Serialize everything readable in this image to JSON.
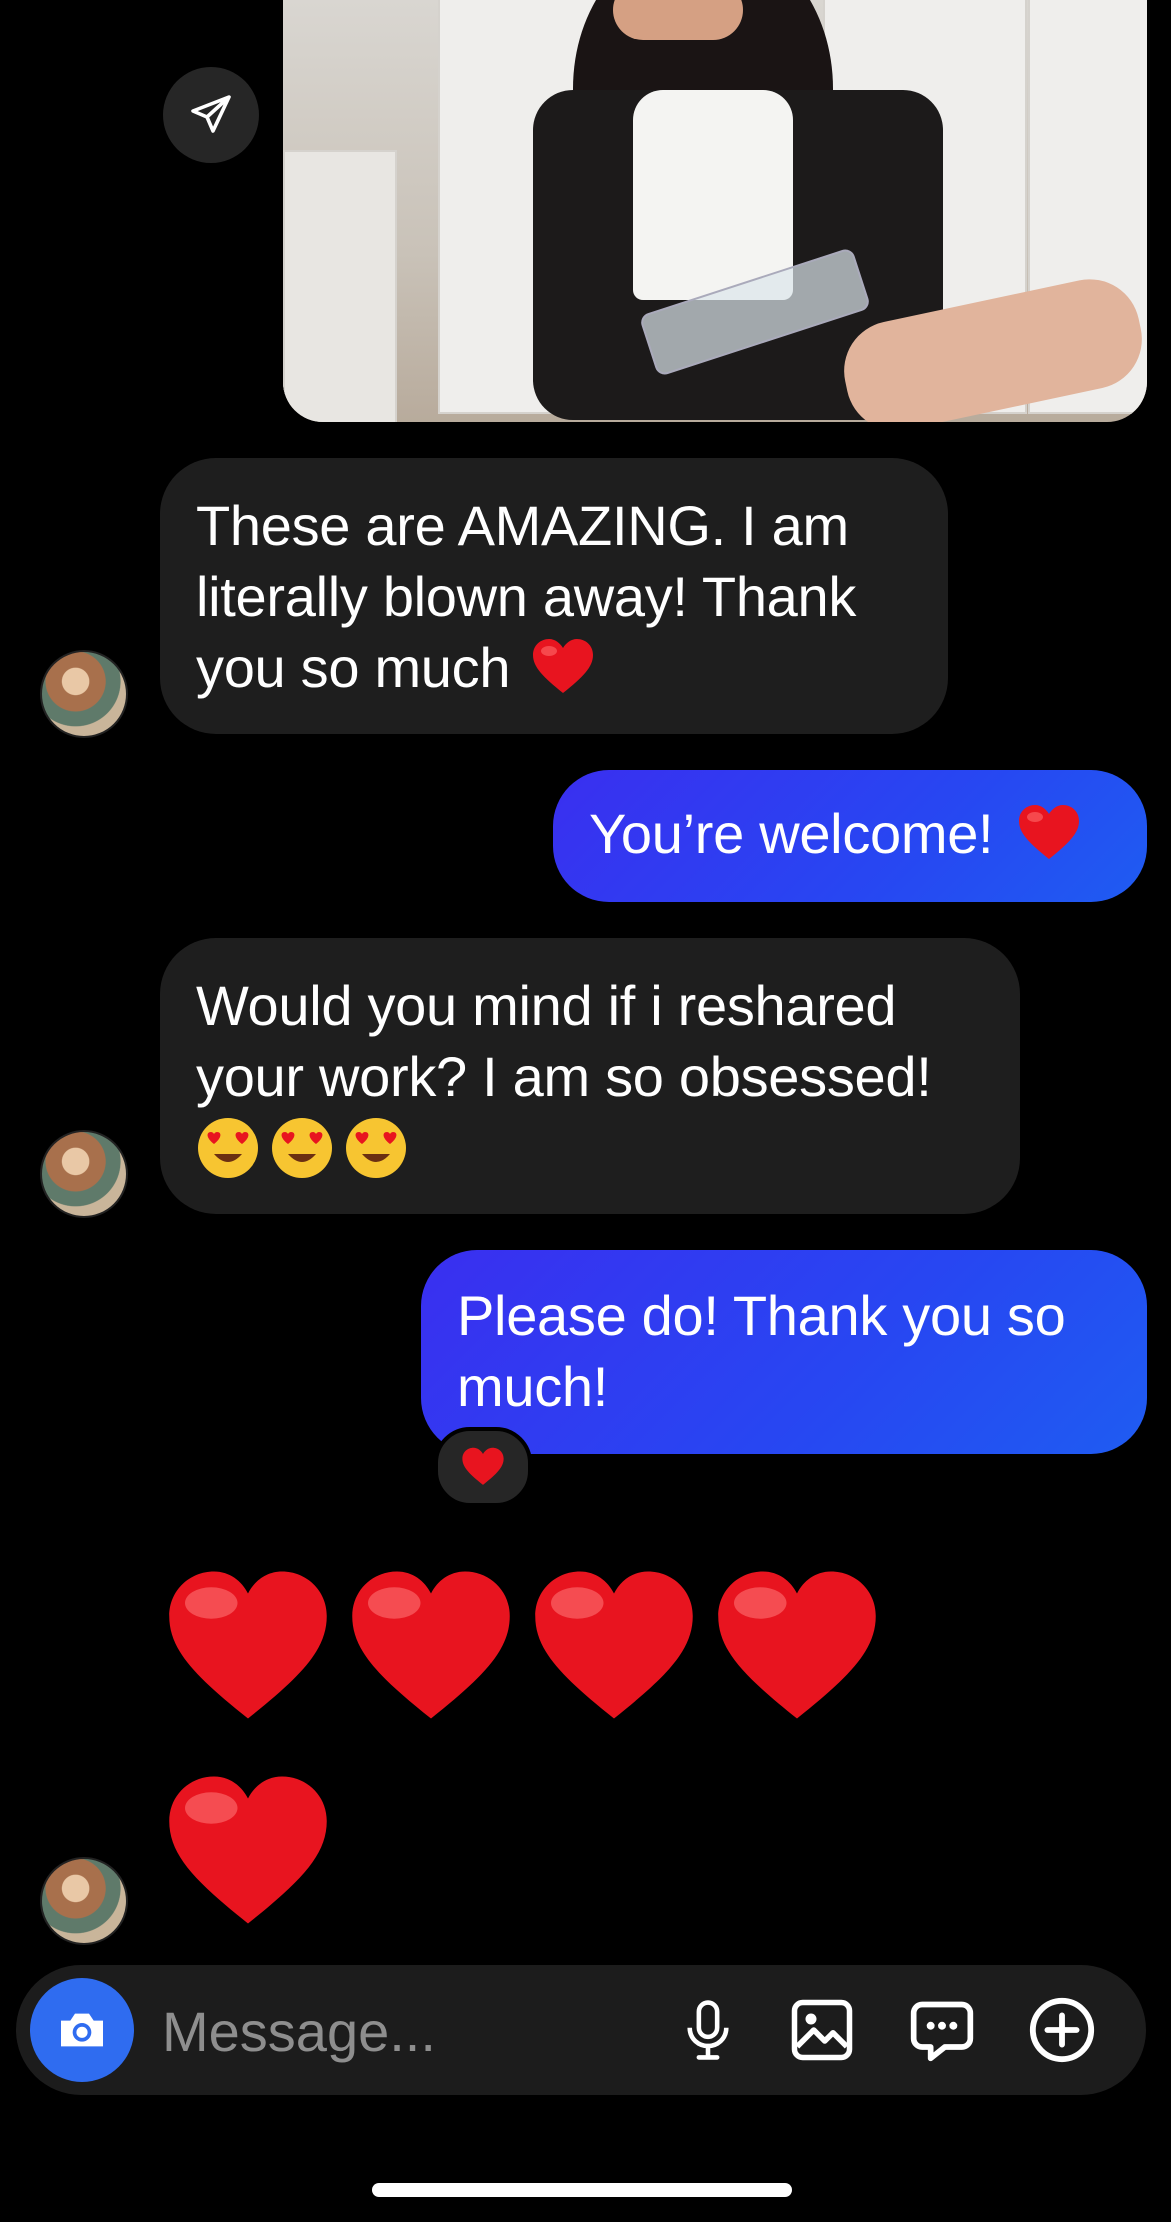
{
  "conversation": {
    "messages": [
      {
        "sender": "them",
        "text": "These are AMAZING. I am literally blown away! Thank you so much",
        "emoji": "red-heart"
      },
      {
        "sender": "me",
        "text": "You’re welcome!",
        "emoji": "red-heart"
      },
      {
        "sender": "them",
        "text": "Would you mind if i reshared your work? I am so obsessed!",
        "emoji": "smiling-face-with-heart-eyes x3"
      },
      {
        "sender": "me",
        "text": "Please do! Thank you so much!",
        "reaction": "red-heart"
      },
      {
        "sender": "them",
        "hearts": 5
      }
    ]
  },
  "msg1": {
    "line1": "These are AMAZING. I am",
    "line2": "literally blown away! Thank",
    "line3": "you so much"
  },
  "msg2": {
    "text": "You’re welcome!"
  },
  "msg3": {
    "line1": "Would you mind if i reshared",
    "line2": "your work? I am so obsessed!"
  },
  "msg4": {
    "line1": "Please do! Thank you so",
    "line2": "much!"
  },
  "composer": {
    "placeholder": "Message..."
  },
  "icons": [
    "paper-plane-icon",
    "camera-icon",
    "microphone-icon",
    "gallery-icon",
    "sticker-chat-icon",
    "plus-icon",
    "red-heart-icon",
    "heart-eyes-emoji"
  ],
  "colors": {
    "background": "#000000",
    "incoming_bubble": "#1e1e1e",
    "outgoing_bubble": "#2f3ff2",
    "camera_button": "#2f6cf0",
    "heart": "#e8141f"
  }
}
